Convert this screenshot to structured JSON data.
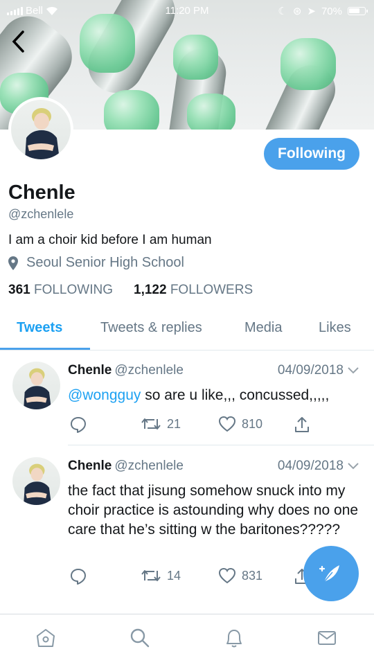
{
  "status_bar": {
    "carrier": "Bell",
    "time": "11:20 PM",
    "battery": "70%"
  },
  "profile": {
    "name": "Chenle",
    "handle": "@zchenlele",
    "bio": "I am a choir kid before I am human",
    "location": "Seoul Senior High School",
    "following_count": "361",
    "following_label": "FOLLOWING",
    "followers_count": "1,122",
    "followers_label": "FOLLOWERS",
    "follow_button": "Following"
  },
  "tabs": [
    {
      "label": "Tweets",
      "active": true
    },
    {
      "label": "Tweets & replies",
      "active": false
    },
    {
      "label": "Media",
      "active": false
    },
    {
      "label": "Likes",
      "active": false
    }
  ],
  "tweets": [
    {
      "name": "Chenle",
      "handle": "@zchenlele",
      "date": "04/09/2018",
      "mention": "@wongguy",
      "text": " so are u like,,, concussed,,,,,",
      "retweets": "21",
      "likes": "810"
    },
    {
      "name": "Chenle",
      "handle": "@zchenlele",
      "date": "04/09/2018",
      "text": "the fact that jisung somehow snuck into my choir practice is astounding why does no one care that he’s sitting w the baritones?????",
      "retweets": "14",
      "likes": "831"
    }
  ],
  "icons": [
    "back-icon",
    "location-pin-icon",
    "reply-icon",
    "retweet-icon",
    "like-icon",
    "share-icon",
    "compose-icon",
    "home-icon",
    "search-icon",
    "notifications-icon",
    "messages-icon",
    "chevron-down-icon"
  ],
  "colors": {
    "accent": "#1da1f2",
    "button": "#4aa1eb",
    "muted": "#657786"
  }
}
